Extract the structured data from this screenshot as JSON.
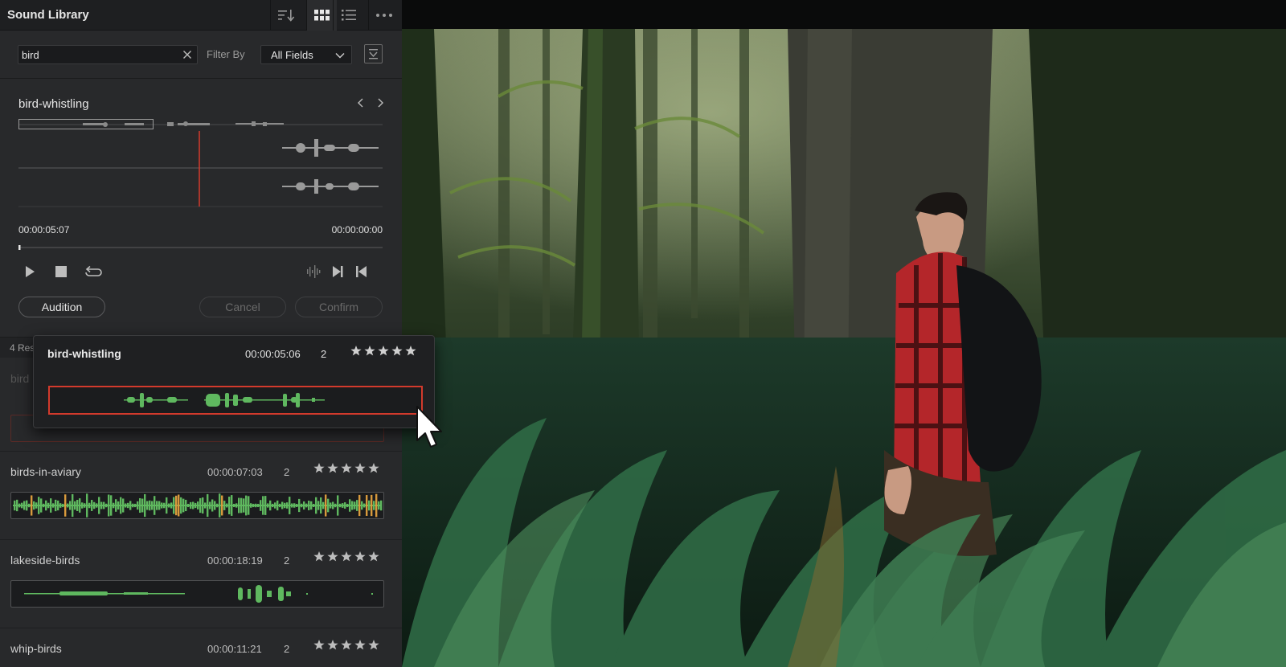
{
  "app": {
    "title": "Sound Library"
  },
  "search": {
    "value": "bird",
    "filter_label": "Filter By",
    "filter_value": "All Fields"
  },
  "preview": {
    "clip_name": "bird-whistling",
    "timecode_left": "00:00:05:07",
    "timecode_right": "00:00:00:00",
    "audition_label": "Audition",
    "cancel_label": "Cancel",
    "confirm_label": "Confirm"
  },
  "results": {
    "count_label": "4 Res",
    "items": [
      {
        "name": "bird",
        "timecode": "",
        "channels": ""
      },
      {
        "name": "birds-in-aviary",
        "timecode": "00:00:07:03",
        "channels": "2"
      },
      {
        "name": "lakeside-birds",
        "timecode": "00:00:18:19",
        "channels": "2"
      },
      {
        "name": "whip-birds",
        "timecode": "00:00:11:21",
        "channels": "2"
      }
    ]
  },
  "popup": {
    "name": "bird-whistling",
    "timecode": "00:00:05:06",
    "channels": "2"
  },
  "colors": {
    "waveform": "#5fb85f",
    "waveform_peak": "#d89a3c",
    "playhead": "#d23a2c",
    "selection": "#d23a2c"
  }
}
